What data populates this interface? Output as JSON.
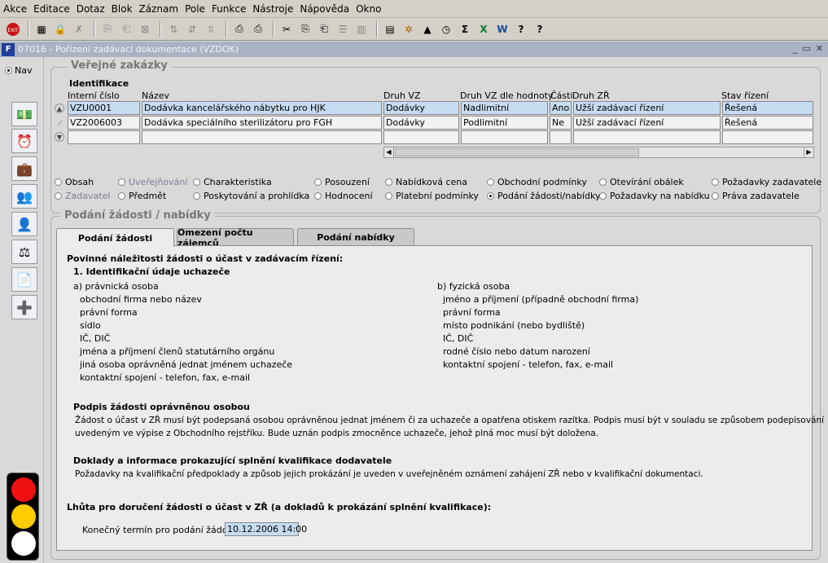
{
  "menu": [
    "Akce",
    "Editace",
    "Dotaz",
    "Blok",
    "Záznam",
    "Pole",
    "Funkce",
    "Nástroje",
    "Nápověda",
    "Okno"
  ],
  "toolbar_icons": [
    "exit-icon",
    "insert-record-icon",
    "lock-icon",
    "delete-icon",
    "copy-icon",
    "paste-icon",
    "clear-icon",
    "sort-asc-icon",
    "sort-desc-icon",
    "sort-icon",
    "print-icon",
    "print-setup-icon",
    "cut-icon",
    "copy2-icon",
    "paste2-icon",
    "list-icon",
    "columns-icon",
    "folder-icon",
    "gear-icon",
    "triangle-icon",
    "clock-icon",
    "sigma-icon",
    "excel-icon",
    "word-icon",
    "help-icon",
    "question-icon"
  ],
  "window": {
    "title": "07016 - Pořízení zadávací dokumentace (VZDOK)"
  },
  "nav": {
    "label": "Nav"
  },
  "verejne": {
    "title": "Veřejné zakázky",
    "identifikace": "Identifikace",
    "columns": [
      "Interní číslo",
      "Název",
      "Druh VZ",
      "Druh VZ dle hodnoty",
      "Části",
      "Druh ZŘ",
      "Stav řízení"
    ],
    "rows": [
      [
        "VZU0001",
        "Dodávka kancelářského nábytku pro HJK",
        "Dodávky",
        "Nadlimitní",
        "Ano",
        "Užší zadávací řízení",
        "Řešená"
      ],
      [
        "VZ2006003",
        "Dodávka speciálního sterilizátoru pro FGH",
        "Dodávky",
        "Podlimitní",
        "Ne",
        "Užší zadávací řízení",
        "Řešená"
      ]
    ]
  },
  "sections": [
    {
      "label": "Obsah",
      "state": "normal"
    },
    {
      "label": "Uveřejňování",
      "state": "disabled"
    },
    {
      "label": "Charakteristika",
      "state": "normal"
    },
    {
      "label": "Posouzení",
      "state": "normal"
    },
    {
      "label": "Nabídková cena",
      "state": "normal"
    },
    {
      "label": "Obchodní podmínky",
      "state": "normal"
    },
    {
      "label": "Otevírání obálek",
      "state": "normal"
    },
    {
      "label": "Požadavky zadavatele",
      "state": "normal"
    },
    {
      "label": "Zadavatel",
      "state": "disabled"
    },
    {
      "label": "Předmět",
      "state": "normal"
    },
    {
      "label": "Poskytování a prohlídka",
      "state": "normal"
    },
    {
      "label": "Hodnocení",
      "state": "normal"
    },
    {
      "label": "Platební podmínky",
      "state": "normal"
    },
    {
      "label": "Podání žádosti/nabídky",
      "state": "selected"
    },
    {
      "label": "Požadavky na nabídku",
      "state": "normal"
    },
    {
      "label": "Práva zadavatele",
      "state": "normal"
    }
  ],
  "podani": {
    "title": "Podání žádosti / nabídky",
    "tabs": [
      "Podání žádosti",
      "Omezení počtu zájemců",
      "Podání nabídky"
    ],
    "heading": "Povinné náležitosti žádosti o účast v zadávacím řízení:",
    "sub1": "1. Identifikační údaje uchazeče",
    "a_title": "a) právnická osoba",
    "a_items": [
      "obchodní firma nebo název",
      "právní forma",
      "sídlo",
      "IČ, DIČ",
      "jména a příjmení členů statutárního orgánu",
      "jiná osoba oprávněná jednat jménem uchazeče",
      "kontaktní spojení - telefon, fax, e-mail"
    ],
    "b_title": "b) fyzická osoba",
    "b_items": [
      "jméno a příjmení (případně obchodní firma)",
      "právní forma",
      "místo podnikání (nebo bydliště)",
      "IČ, DIČ",
      "rodné číslo nebo datum narození",
      "kontaktní spojení - telefon, fax, e-mail"
    ],
    "podpis_title": "Podpis žádosti oprávněnou osobou",
    "podpis_l1": "Žádost o účast v ZŘ musí být podepsaná osobou oprávněnou jednat jménem či za uchazeče a opatřena otiskem razítka. Podpis musí být v souladu se způsobem podepisování",
    "podpis_l2": "uvedeným ve výpise z Obchodního rejstříku. Bude uznán podpis zmocněnce uchazeče, jehož plná moc musí být doložena.",
    "doklady_title": "Doklady a informace prokazující splnění kvalifikace dodavatele",
    "doklady_text": "Požadavky na kvalifikační předpoklady a způsob jejich prokázání je uveden v uveřejněném oznámení zahájení ZŘ nebo v kvalifikační dokumentaci.",
    "lhuta_title": "Lhůta pro doručení žádosti o účast v ZŘ (a dokladů k prokázání splnění kvalifikace):",
    "termin_label": "Konečný termín pro podání žádosti:",
    "termin_value": "10.12.2006 14:00"
  }
}
